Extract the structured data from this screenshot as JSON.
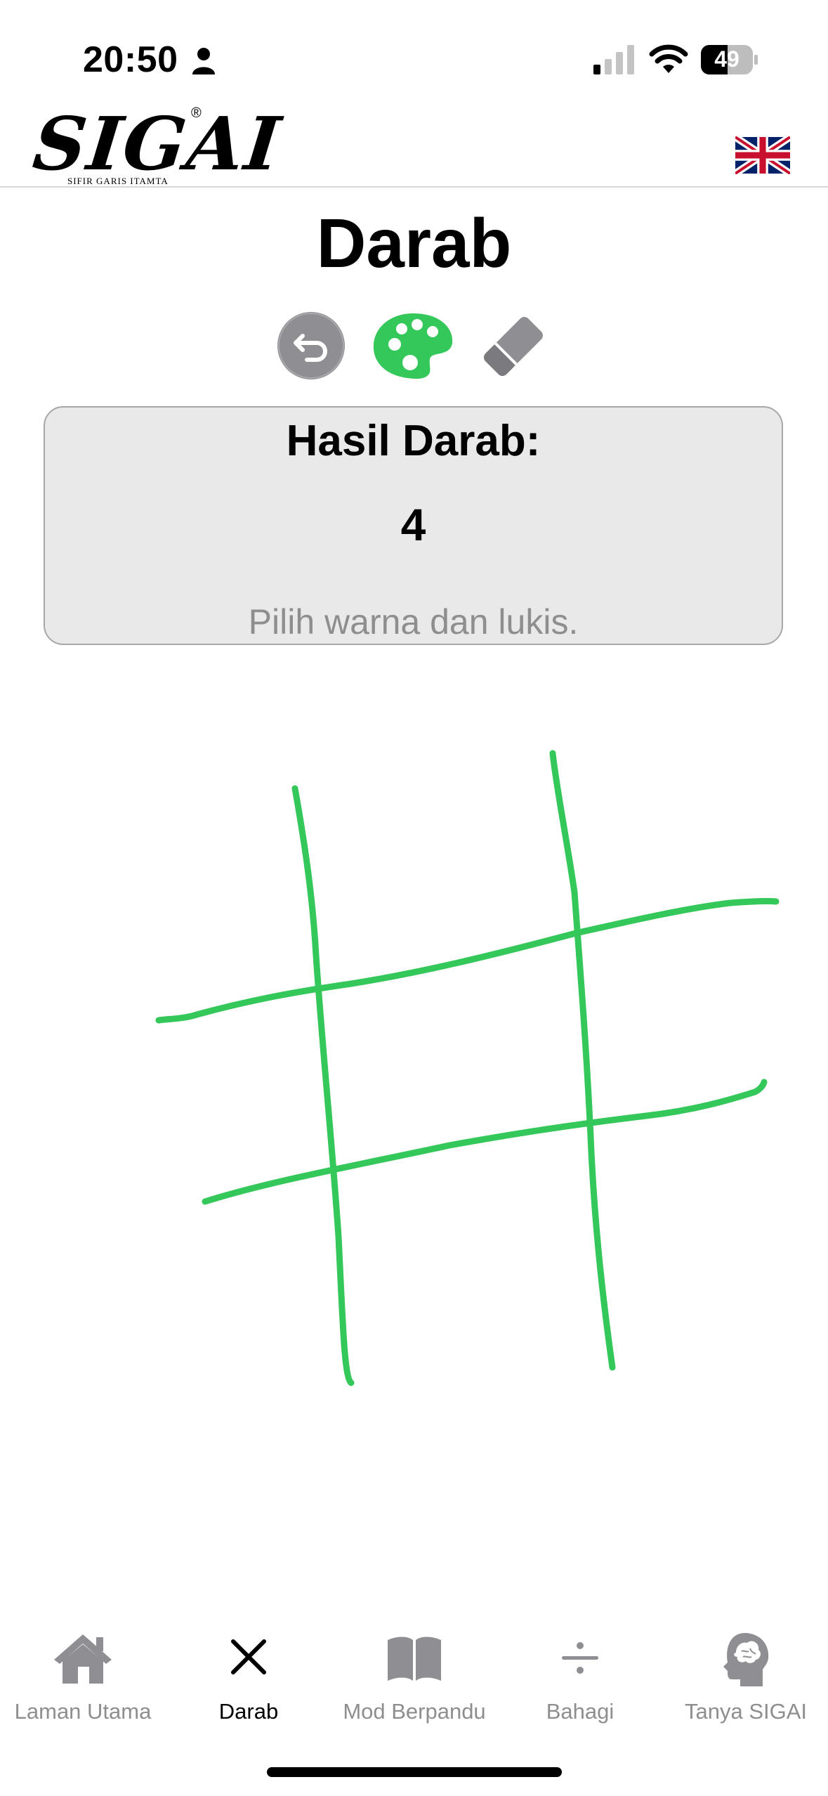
{
  "status_bar": {
    "time": "20:50",
    "battery": "49"
  },
  "header": {
    "logo_text": "SIGAI",
    "logo_registered": "®",
    "logo_subtitle": "SIFIR GARIS ITAMTA",
    "language_flag": "uk-flag-icon"
  },
  "page": {
    "title": "Darab"
  },
  "toolbar": {
    "undo_icon": "undo-icon",
    "palette_icon": "palette-icon",
    "eraser_icon": "eraser-icon",
    "active_color": "#34c759"
  },
  "result": {
    "label": "Hasil Darab:",
    "value": "4",
    "hint": "Pilih warna dan lukis."
  },
  "tabs": [
    {
      "label": "Laman Utama",
      "icon": "home-icon",
      "active": false
    },
    {
      "label": "Darab",
      "icon": "multiply-icon",
      "active": true
    },
    {
      "label": "Mod Berpandu",
      "icon": "book-icon",
      "active": false
    },
    {
      "label": "Bahagi",
      "icon": "divide-icon",
      "active": false
    },
    {
      "label": "Tanya SIGAI",
      "icon": "brain-head-icon",
      "active": false
    }
  ]
}
